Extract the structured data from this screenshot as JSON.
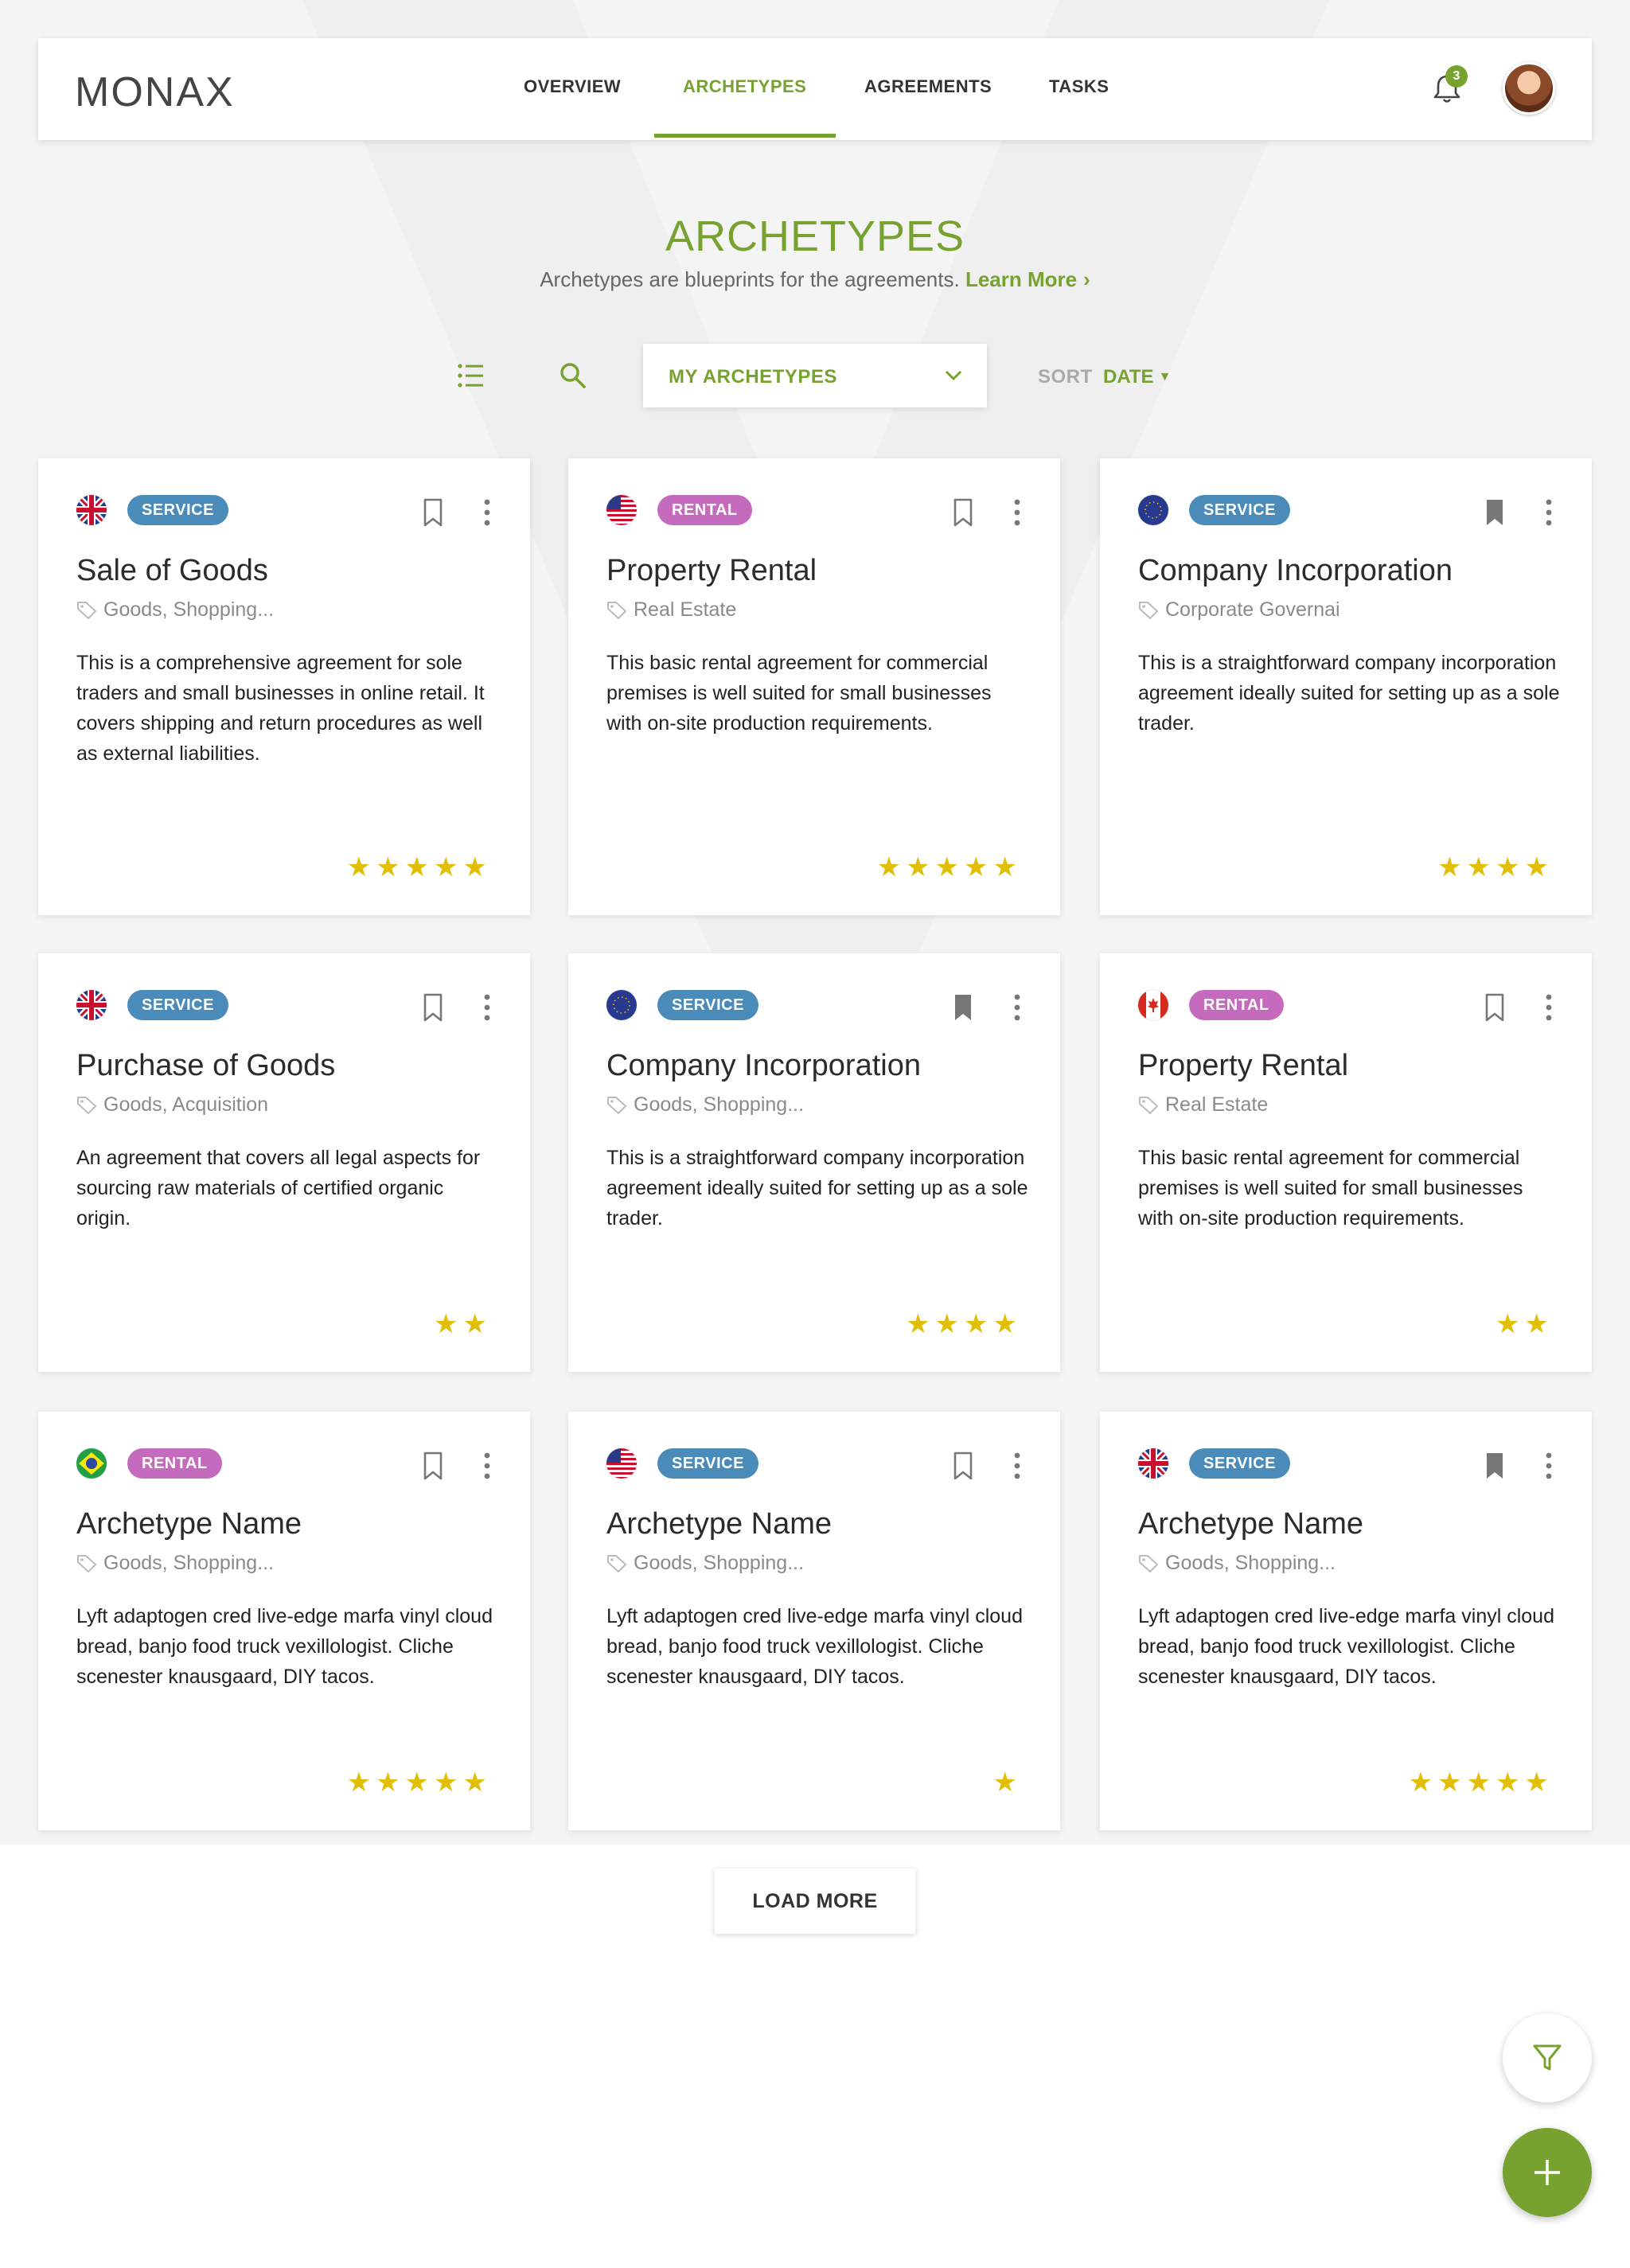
{
  "brand": {
    "logo_text": "MONAX",
    "accent": "#78a22f"
  },
  "nav": {
    "items": [
      {
        "label": "OVERVIEW"
      },
      {
        "label": "ARCHETYPES",
        "active": true
      },
      {
        "label": "AGREEMENTS"
      },
      {
        "label": "TASKS"
      }
    ],
    "notifications_count": "3"
  },
  "page": {
    "title": "ARCHETYPES",
    "subtitle": "Archetypes are blueprints for the agreements.",
    "learn_more": "Learn More"
  },
  "toolbar": {
    "filter_value": "MY ARCHETYPES",
    "sort_label": "SORT",
    "sort_value": "DATE"
  },
  "cards": [
    {
      "flag": "uk",
      "badge": "SERVICE",
      "title": "Sale of Goods",
      "tags": "Goods, Shopping...",
      "desc": "This is a comprehensive agreement for sole traders and small businesses in online retail. It covers shipping and return procedures as well as external liabilities.",
      "rating": 5,
      "stars": "★★★★★",
      "bookmarked": false
    },
    {
      "flag": "us",
      "badge": "RENTAL",
      "title": "Property Rental",
      "tags": "Real Estate",
      "desc": "This basic rental agreement for commercial premises is well suited for small businesses with on-site production requirements.",
      "rating": 5,
      "stars": "★★★★★",
      "bookmarked": false
    },
    {
      "flag": "eu",
      "badge": "SERVICE",
      "title": "Company Incorporation",
      "tags": "Corporate Governai",
      "desc": "This is a straightforward company incorporation agreement ideally suited for setting up as a sole trader.",
      "rating": 4,
      "stars": "★★★★",
      "bookmarked": true
    },
    {
      "flag": "uk",
      "badge": "SERVICE",
      "title": "Purchase of Goods",
      "tags": "Goods, Acquisition",
      "desc": "An agreement that covers all legal aspects for sourcing raw materials of certified organic origin.",
      "rating": 2,
      "stars": "★★",
      "bookmarked": false
    },
    {
      "flag": "eu",
      "badge": "SERVICE",
      "title": "Company Incorporation",
      "tags": "Goods, Shopping...",
      "desc": "This is a straightforward company incorporation agreement ideally suited for setting up as a sole trader.",
      "rating": 4,
      "stars": "★★★★",
      "bookmarked": true
    },
    {
      "flag": "ca",
      "badge": "RENTAL",
      "title": "Property Rental",
      "tags": "Real Estate",
      "desc": "This basic rental agreement for commercial premises is well suited for small businesses with on-site production requirements.",
      "rating": 2,
      "stars": "★★",
      "bookmarked": false
    },
    {
      "flag": "br",
      "badge": "RENTAL",
      "title": "Archetype Name",
      "tags": "Goods, Shopping...",
      "desc": "Lyft adaptogen cred live-edge marfa vinyl cloud bread, banjo food truck vexillologist. Cliche scenester knausgaard, DIY tacos.",
      "rating": 5,
      "stars": "★★★★★",
      "bookmarked": false
    },
    {
      "flag": "us",
      "badge": "SERVICE",
      "title": "Archetype Name",
      "tags": "Goods, Shopping...",
      "desc": "Lyft adaptogen cred live-edge marfa vinyl cloud bread, banjo food truck vexillologist. Cliche scenester knausgaard, DIY tacos.",
      "rating": 1,
      "stars": "★",
      "bookmarked": false
    },
    {
      "flag": "uk",
      "badge": "SERVICE",
      "title": "Archetype Name",
      "tags": "Goods, Shopping...",
      "desc": "Lyft adaptogen cred live-edge marfa vinyl cloud bread, banjo food truck vexillologist. Cliche scenester knausgaard, DIY tacos.",
      "rating": 5,
      "stars": "★★★★★",
      "bookmarked": true
    }
  ],
  "load_more": "LOAD MORE",
  "fabs": {
    "filter_icon": "filter-icon",
    "add_icon": "plus-icon"
  }
}
